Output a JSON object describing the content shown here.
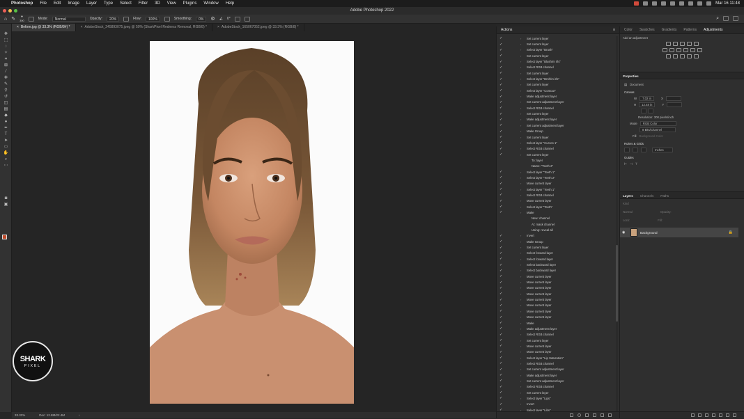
{
  "menubar": {
    "app_name": "Photoshop",
    "items": [
      "File",
      "Edit",
      "Image",
      "Layer",
      "Type",
      "Select",
      "Filter",
      "3D",
      "View",
      "Plugins",
      "Window",
      "Help"
    ],
    "datetime": "Mar 16  11:48"
  },
  "window": {
    "title": "Adobe Photoshop 2022"
  },
  "options_bar": {
    "mode_label": "Mode:",
    "mode_value": "Normal",
    "opacity_label": "Opacity:",
    "opacity_value": "20%",
    "flow_label": "Flow:",
    "flow_value": "100%",
    "smoothing_label": "Smoothing:",
    "smoothing_value": "0%",
    "brush_size": "300",
    "angle_value": "0°"
  },
  "tabs": [
    {
      "label": "Before.jpg @ 33.3% (RGB/8#) *",
      "active": true
    },
    {
      "label": "AdobeStock_245893075.jpeg @ 50% (SharkPixel Redness Removal, RGB/8) *",
      "active": false
    },
    {
      "label": "AdobeStock_165067052.jpeg @ 33.3% (RGB/8) *",
      "active": false
    }
  ],
  "status": {
    "zoom": "33.33%",
    "doc_size": "Doc: 12.8M/22.4M"
  },
  "logo": {
    "line1": "SHARK",
    "line2": "PIXEL"
  },
  "actions_panel": {
    "title": "Actions",
    "rows": [
      {
        "text": "Set current layer",
        "sub": false
      },
      {
        "text": "Set current layer",
        "sub": false
      },
      {
        "text": "Select layer \"Brush\"",
        "sub": false
      },
      {
        "text": "Set current layer",
        "sub": false
      },
      {
        "text": "Select layer \"Blush/m irls\"",
        "sub": false
      },
      {
        "text": "Select RGB channel",
        "sub": false
      },
      {
        "text": "Set current layer",
        "sub": false
      },
      {
        "text": "Select layer \"Brsh/m irls\"",
        "sub": false
      },
      {
        "text": "Set current layer",
        "sub": false
      },
      {
        "text": "Select layer \"Contour\"",
        "sub": false
      },
      {
        "text": "Make adjustment layer",
        "sub": false
      },
      {
        "text": "Set current adjustment layer",
        "sub": false
      },
      {
        "text": "Select RGB channel",
        "sub": false
      },
      {
        "text": "Set current layer",
        "sub": false
      },
      {
        "text": "Make adjustment layer",
        "sub": false
      },
      {
        "text": "Set current adjustment layer",
        "sub": false
      },
      {
        "text": "Make Group",
        "sub": false
      },
      {
        "text": "Set current layer",
        "sub": false
      },
      {
        "text": "Select layer \"Curves 1\"",
        "sub": false
      },
      {
        "text": "Select RGB channel",
        "sub": false
      },
      {
        "text": "Set current layer",
        "sub": false
      },
      {
        "text": "To: layer",
        "sub": true
      },
      {
        "text": "Name: \"Teeth 2\"",
        "sub": true
      },
      {
        "text": "Select layer \"Teeth 1\"",
        "sub": false
      },
      {
        "text": "Select layer \"Teeth 2\"",
        "sub": false
      },
      {
        "text": "Move current layer",
        "sub": false
      },
      {
        "text": "Select layer \"Teeth 1\"",
        "sub": false
      },
      {
        "text": "Select RGB channel",
        "sub": false
      },
      {
        "text": "Move current layer",
        "sub": false
      },
      {
        "text": "Select layer \"Teeth\"",
        "sub": false
      },
      {
        "text": "Make",
        "sub": false
      },
      {
        "text": "New: channel",
        "sub": true
      },
      {
        "text": "At: mask channel",
        "sub": true
      },
      {
        "text": "Using: reveal all",
        "sub": true
      },
      {
        "text": "Invert",
        "sub": false
      },
      {
        "text": "Make Group",
        "sub": false
      },
      {
        "text": "Set current layer",
        "sub": false
      },
      {
        "text": "Select forward layer",
        "sub": false
      },
      {
        "text": "Select forward layer",
        "sub": false
      },
      {
        "text": "Select backward layer",
        "sub": false
      },
      {
        "text": "Select backward layer",
        "sub": false
      },
      {
        "text": "Move current layer",
        "sub": false
      },
      {
        "text": "Move current layer",
        "sub": false
      },
      {
        "text": "Move current layer",
        "sub": false
      },
      {
        "text": "Move current layer",
        "sub": false
      },
      {
        "text": "Move current layer",
        "sub": false
      },
      {
        "text": "Move current layer",
        "sub": false
      },
      {
        "text": "Move current layer",
        "sub": false
      },
      {
        "text": "Move current layer",
        "sub": false
      },
      {
        "text": "Make",
        "sub": false
      },
      {
        "text": "Make adjustment layer",
        "sub": false
      },
      {
        "text": "Select RGB channel",
        "sub": false
      },
      {
        "text": "Set current layer",
        "sub": false
      },
      {
        "text": "Move current layer",
        "sub": false
      },
      {
        "text": "Move current layer",
        "sub": false
      },
      {
        "text": "Select layer \"Lip Saturation\"",
        "sub": false
      },
      {
        "text": "Select RGB channel",
        "sub": false
      },
      {
        "text": "Set current adjustment layer",
        "sub": false
      },
      {
        "text": "Make adjustment layer",
        "sub": false
      },
      {
        "text": "Set current adjustment layer",
        "sub": false
      },
      {
        "text": "Select RGB channel",
        "sub": false
      },
      {
        "text": "Set current layer",
        "sub": false
      },
      {
        "text": "Select layer \"Lips\"",
        "sub": false
      },
      {
        "text": "Invert",
        "sub": false
      },
      {
        "text": "Select layer \"Libs\"",
        "sub": false
      },
      {
        "text": "Move current layer",
        "sub": false
      }
    ]
  },
  "right_tabs": [
    "Color",
    "Swatches",
    "Gradients",
    "Patterns",
    "Adjustments"
  ],
  "adjustments": {
    "hint": "Add an adjustment"
  },
  "properties": {
    "title": "Properties",
    "doc_label": "Document",
    "canvas_title": "Canvas",
    "w_label": "W",
    "w_value": "7.02 in",
    "h_label": "H",
    "h_value": "12.48 in",
    "x_label": "X",
    "y_label": "Y",
    "resolution": "Resolution: 300 pixels/inch",
    "mode_label": "Mode",
    "mode_value": "RGB Color",
    "depth_value": "8 Bits/Channel",
    "fill_label": "Fill",
    "fill_value": "Background Color",
    "rulers_title": "Rulers & Grids",
    "units_value": "Inches",
    "guides_title": "Guides"
  },
  "layers_panel": {
    "tabs": [
      "Layers",
      "Channels",
      "Paths"
    ],
    "kind_label": "Kind",
    "blend_label": "Normal",
    "opacity_label": "Opacity:",
    "lock_label": "Lock:",
    "fill_label": "Fill:",
    "layer_name": "Background"
  },
  "colors": {
    "accent": "#c04a2a",
    "panel_bg": "#2f2f2f",
    "canvas_bg": "#252525"
  }
}
